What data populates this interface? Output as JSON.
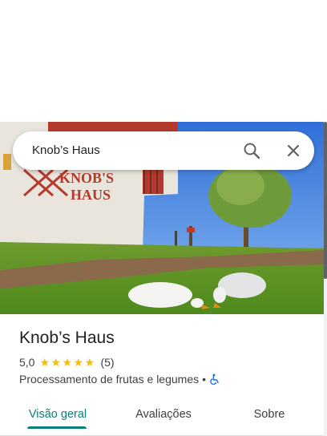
{
  "search": {
    "query": "Knob’s Haus"
  },
  "place": {
    "name": "Knob’s Haus",
    "rating": "5,0",
    "stars": [
      "★",
      "★",
      "★",
      "★",
      "★"
    ],
    "review_count": "(5)",
    "category": "Processamento de frutas e legumes",
    "separator": "•"
  },
  "photo": {
    "sign_line1": "KNOB'S",
    "sign_line2": "HAUS"
  },
  "tabs": [
    {
      "label": "Visão geral",
      "active": true
    },
    {
      "label": "Avaliações",
      "active": false
    },
    {
      "label": "Sobre",
      "active": false
    }
  ],
  "colors": {
    "accent": "#0b7f7c",
    "star": "#fbbc04",
    "accessibility": "#1a73e8"
  },
  "icons": [
    "search-icon",
    "close-icon",
    "wheelchair-icon"
  ]
}
